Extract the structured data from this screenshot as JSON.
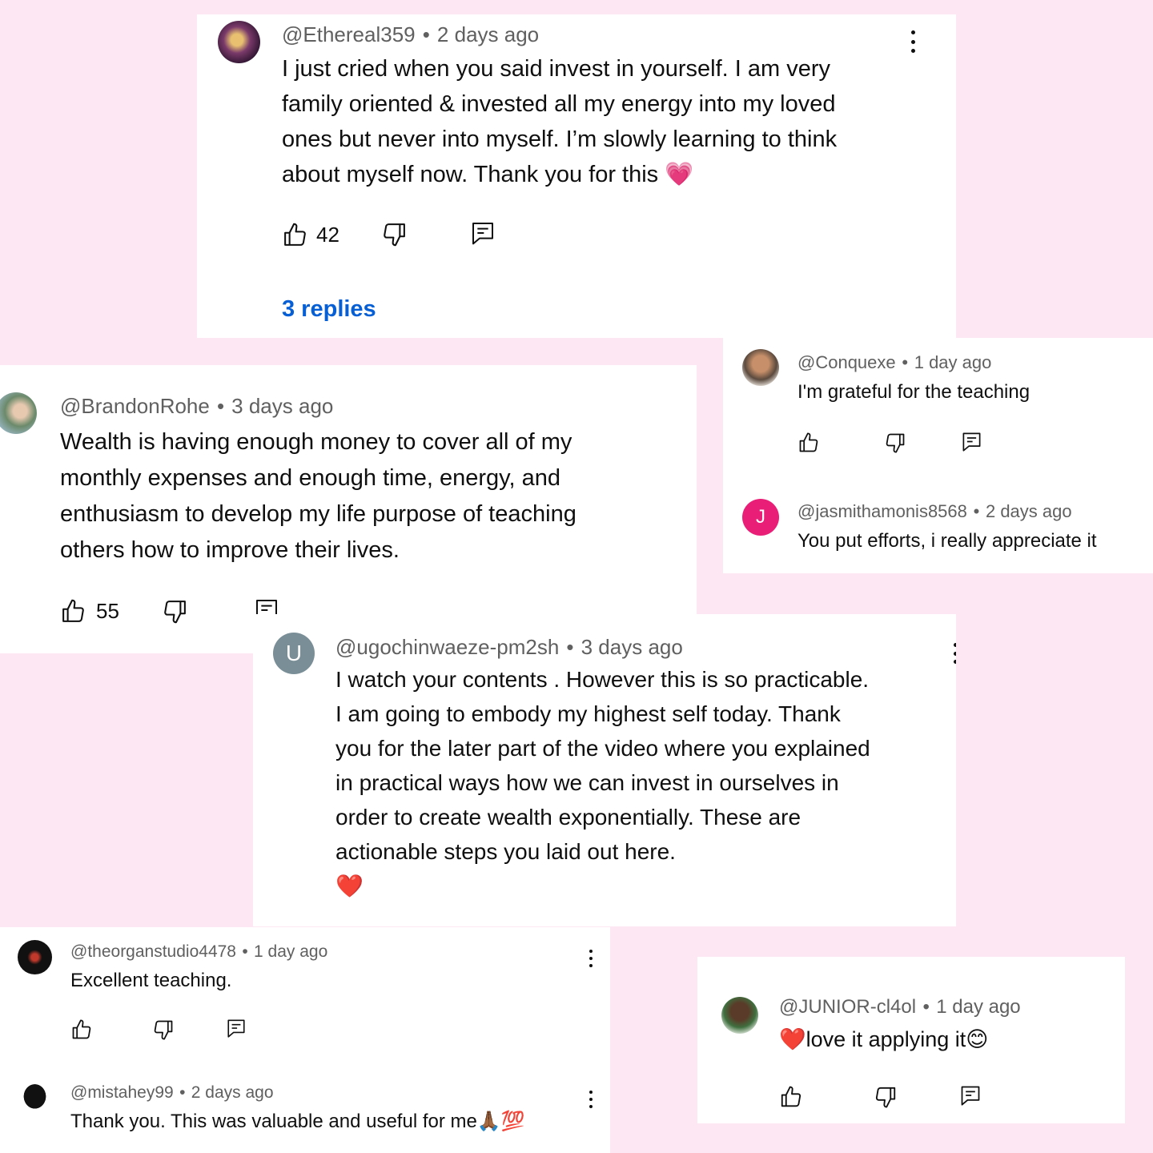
{
  "comments": {
    "ethereal": {
      "handle": "@Ethereal359",
      "time": "2 days ago",
      "lines": [
        "I just cried when you said invest in yourself. I am very",
        "family oriented & invested all my energy into my loved",
        "ones but never into myself. I’m slowly learning to think",
        "about myself now. Thank you for this 💗"
      ],
      "likes": "42",
      "replies": "3 replies"
    },
    "brandon": {
      "handle": "@BrandonRohe",
      "time": "3 days ago",
      "lines": [
        "Wealth is having enough money to cover all of my",
        "monthly expenses and enough time, energy, and",
        "enthusiasm to develop my life purpose of teaching",
        "others how to improve their lives."
      ],
      "likes": "55"
    },
    "conquexe": {
      "handle": "@Conquexe",
      "time": "1 day ago",
      "text": "I'm grateful for the teaching"
    },
    "jasmitha": {
      "handle": "@jasmithamonis8568",
      "time": "2 days ago",
      "avatar_letter": "J",
      "text": "You put efforts, i really appreciate it"
    },
    "ugochi": {
      "handle": "@ugochinwaeze-pm2sh",
      "time": "3 days ago",
      "avatar_letter": "U",
      "lines": [
        "I watch your contents . However this is so practicable.",
        "I am going to embody my highest self today. Thank",
        "you for the later part of the video where you explained",
        "in practical ways how we can invest in ourselves in",
        "order to create wealth exponentially. These are",
        "actionable steps you laid out here.",
        "❤️"
      ]
    },
    "organ": {
      "handle": "@theorganstudio4478",
      "time": "1 day ago",
      "text": "Excellent teaching."
    },
    "mistahey": {
      "handle": "@mistahey99",
      "time": "2 days ago",
      "text": "Thank you. This was valuable and useful for me🙏🏾💯"
    },
    "junior": {
      "handle": "@JUNIOR-cl4ol",
      "time": "1 day ago",
      "text": "❤️love it applying it😊"
    }
  },
  "colors": {
    "background": "#fde7f3",
    "card": "#ffffff",
    "meta_text": "#606060",
    "link_blue": "#065fd4",
    "avatar_pink": "#e91e77",
    "avatar_gray": "#7a8e97"
  },
  "icons": [
    "thumbs-up-icon",
    "thumbs-down-icon",
    "reply-icon",
    "more-vert-icon"
  ]
}
